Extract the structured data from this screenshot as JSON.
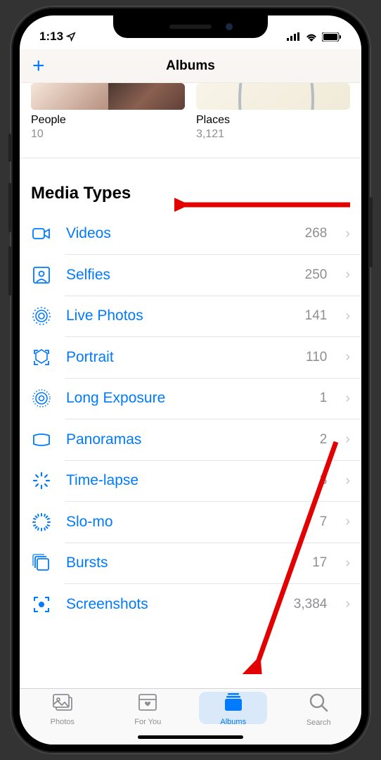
{
  "status": {
    "time": "1:13",
    "location_icon": "location-arrow"
  },
  "header": {
    "title": "Albums",
    "add_label": "+"
  },
  "albums": [
    {
      "name": "People",
      "count": "10",
      "thumb_style": "people"
    },
    {
      "name": "Places",
      "count": "3,121",
      "thumb_style": "places"
    }
  ],
  "section": {
    "title": "Media Types"
  },
  "media_types": [
    {
      "icon": "video",
      "label": "Videos",
      "count": "268"
    },
    {
      "icon": "selfie",
      "label": "Selfies",
      "count": "250"
    },
    {
      "icon": "livephoto",
      "label": "Live Photos",
      "count": "141"
    },
    {
      "icon": "portrait",
      "label": "Portrait",
      "count": "110"
    },
    {
      "icon": "longexposure",
      "label": "Long Exposure",
      "count": "1"
    },
    {
      "icon": "panorama",
      "label": "Panoramas",
      "count": "2"
    },
    {
      "icon": "timelapse",
      "label": "Time-lapse",
      "count": "3"
    },
    {
      "icon": "slomo",
      "label": "Slo-mo",
      "count": "7"
    },
    {
      "icon": "burst",
      "label": "Bursts",
      "count": "17"
    },
    {
      "icon": "screenshot",
      "label": "Screenshots",
      "count": "3,384"
    }
  ],
  "tabs": [
    {
      "icon": "photos",
      "label": "Photos",
      "active": false
    },
    {
      "icon": "foryou",
      "label": "For You",
      "active": false
    },
    {
      "icon": "albums",
      "label": "Albums",
      "active": true
    },
    {
      "icon": "search",
      "label": "Search",
      "active": false
    }
  ]
}
